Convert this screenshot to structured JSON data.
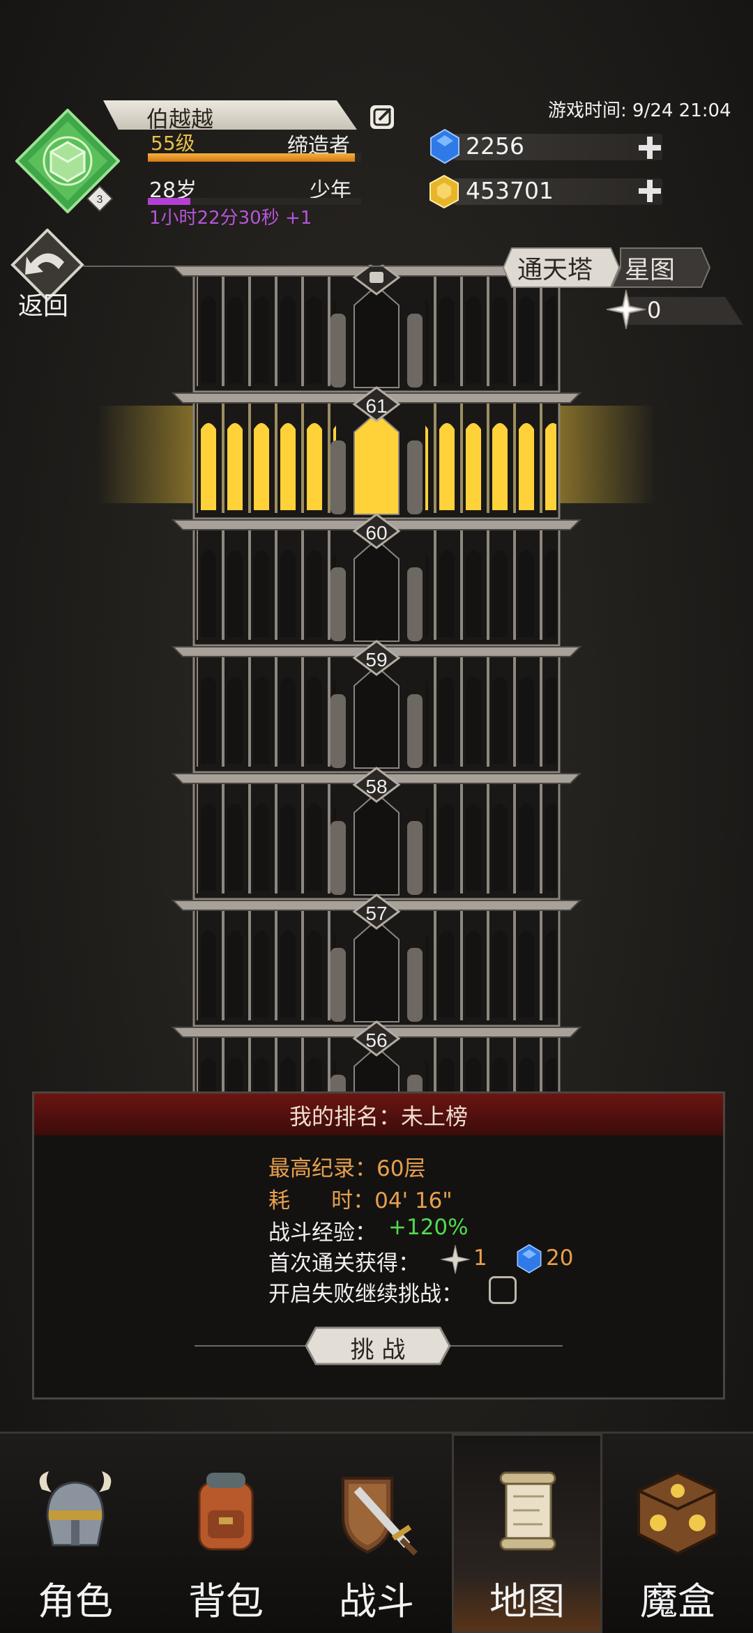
{
  "player": {
    "name": "伯越越",
    "rank_badge": "3",
    "level": "55级",
    "title": "缔造者",
    "exp_fraction": 0.97,
    "age": "28岁",
    "life_stage": "少年",
    "age_fraction": 0.2,
    "timer": "1小时22分30秒 +1"
  },
  "header": {
    "game_time": "游戏时间: 9/24 21:04"
  },
  "currencies": [
    {
      "name": "blue-gem",
      "amount": "2256",
      "color": "#2f7ae8"
    },
    {
      "name": "gold-gem",
      "amount": "453701",
      "color": "#e8b52a"
    }
  ],
  "nav_top": {
    "back_label": "返回",
    "tabs": [
      {
        "label": "通天塔",
        "active": true
      },
      {
        "label": "星图",
        "active": false
      }
    ],
    "star_count": "0"
  },
  "tower": {
    "top_floor_locked": true,
    "floors": [
      "61",
      "60",
      "59",
      "58",
      "57",
      "56"
    ],
    "current_floor": "61"
  },
  "panel": {
    "rank": "我的排名：未上榜",
    "best_record": "最高纪录：60层",
    "time_used": "耗      时：04' 16\"",
    "exp_label": "战斗经验：",
    "exp_bonus": "+120%",
    "first_clear_label": "首次通关获得：",
    "reward_star": "1",
    "reward_gem": "20",
    "continue_label": "开启失败继续挑战：",
    "continue_checked": false,
    "challenge_label": "挑 战"
  },
  "bottom_nav": [
    {
      "label": "角色",
      "icon": "helmet-icon",
      "active": false
    },
    {
      "label": "背包",
      "icon": "backpack-icon",
      "active": false
    },
    {
      "label": "战斗",
      "icon": "sword-shield-icon",
      "active": false
    },
    {
      "label": "地图",
      "icon": "scroll-map-icon",
      "active": true
    },
    {
      "label": "魔盒",
      "icon": "magic-box-icon",
      "active": false
    }
  ],
  "colors": {
    "accent_gold": "#e7a04d",
    "bonus_green": "#4fdc4f",
    "rank_header_red": "#6b1512",
    "glow_yellow": "#ffd23a"
  }
}
